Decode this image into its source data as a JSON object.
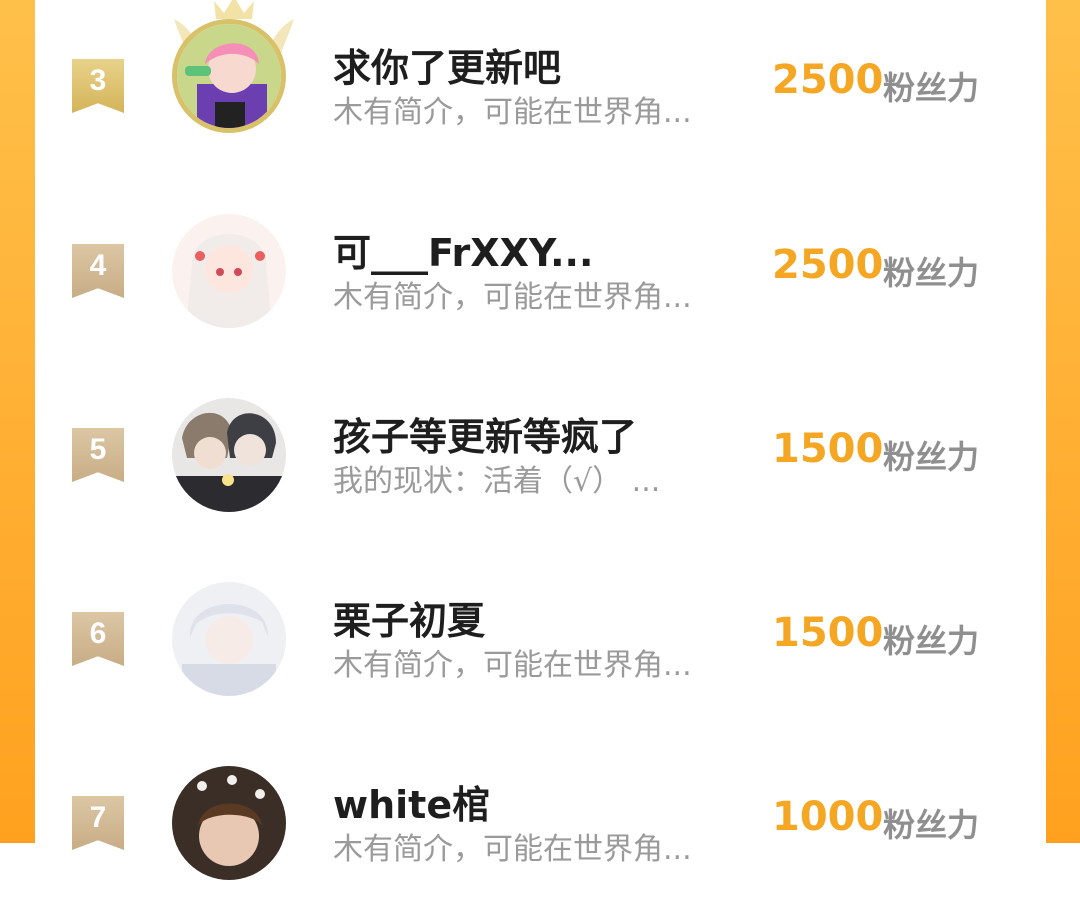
{
  "colors": {
    "frame": "#ffa11f",
    "score": "#f5a623",
    "name": "#1e1e1e",
    "bio": "#9a9a9a",
    "unit": "#8f8f8f",
    "rank_badge": "#c8ad86"
  },
  "score_unit": "粉丝力",
  "fans": [
    {
      "rank": "3",
      "name": "求你了更新吧",
      "bio": "木有简介，可能在世界角...",
      "score": "2500",
      "avatar_icon": "avatar-pink-hair-boy-icon",
      "crown": true
    },
    {
      "rank": "4",
      "name": "可___FrXXY...",
      "bio": "木有简介，可能在世界角...",
      "score": "2500",
      "avatar_icon": "avatar-white-hair-girl-icon",
      "crown": false
    },
    {
      "rank": "5",
      "name": "孩子等更新等疯了",
      "bio": "我的现状：活着（√） ...",
      "score": "1500",
      "avatar_icon": "avatar-two-boys-icon",
      "crown": false
    },
    {
      "rank": "6",
      "name": "栗子初夏",
      "bio": "木有简介，可能在世界角...",
      "score": "1500",
      "avatar_icon": "avatar-pale-boy-icon",
      "crown": false
    },
    {
      "rank": "7",
      "name": "white棺",
      "bio": "木有简介，可能在世界角...",
      "score": "1000",
      "avatar_icon": "avatar-child-butterflies-icon",
      "crown": false
    }
  ]
}
